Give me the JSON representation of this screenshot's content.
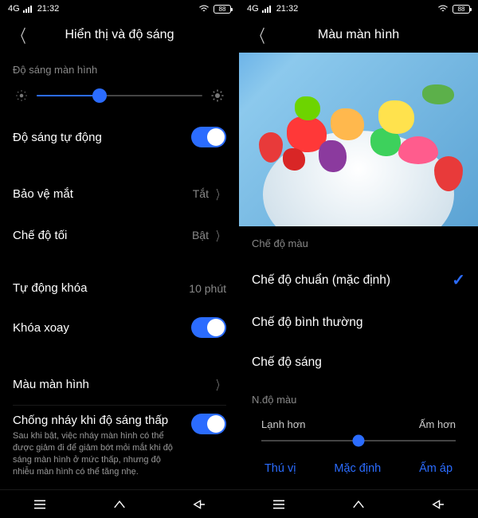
{
  "status": {
    "net": "4G",
    "time": "21:32",
    "battery": "88"
  },
  "left": {
    "title": "Hiển thị và độ sáng",
    "brightness_label": "Độ sáng màn hình",
    "brightness_pct": 38,
    "auto_brightness": "Độ sáng tự động",
    "eye_protect": "Bảo vệ mắt",
    "eye_protect_val": "Tắt",
    "dark_mode": "Chế độ tối",
    "dark_mode_val": "Bật",
    "auto_lock": "Tự động khóa",
    "auto_lock_val": "10 phút",
    "rotation_lock": "Khóa xoay",
    "screen_color": "Màu màn hình",
    "anti_flicker": "Chống nháy khi độ sáng thấp",
    "anti_flicker_desc": "Sau khi bật, việc nháy màn hình có thể được giảm đi để giảm bớt mỏi mắt khi độ sáng màn hình ở mức thấp, nhưng độ nhiễu màn hình có thể tăng nhẹ."
  },
  "right": {
    "title": "Màu màn hình",
    "color_mode_label": "Chế độ màu",
    "options": [
      "Chế độ chuẩn (mặc định)",
      "Chế độ bình thường",
      "Chế độ sáng"
    ],
    "selected": 0,
    "temp_label": "N.độ màu",
    "cooler": "Lạnh hơn",
    "warmer": "Ấm hơn",
    "presets": [
      "Thú vị",
      "Mặc định",
      "Ấm áp"
    ]
  }
}
